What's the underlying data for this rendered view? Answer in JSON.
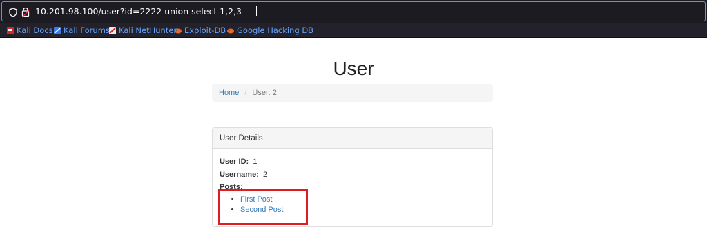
{
  "browser": {
    "url": "10.201.98.100/user?id=2222 union select 1,2,3-- -",
    "bookmarks": [
      {
        "label": "Kali Docs",
        "icon": "kali-docs-icon"
      },
      {
        "label": "Kali Forums",
        "icon": "kali-forums-icon"
      },
      {
        "label": "Kali NetHunter",
        "icon": "kali-nethunter-icon"
      },
      {
        "label": "Exploit-DB",
        "icon": "exploit-db-icon"
      },
      {
        "label": "Google Hacking DB",
        "icon": "google-hacking-db-icon"
      }
    ]
  },
  "page": {
    "title": "User",
    "breadcrumb": {
      "home": "Home",
      "separator": "/",
      "current": "User: 2"
    },
    "panel": {
      "heading": "User Details",
      "user_id_label": "User ID:",
      "user_id_value": "1",
      "username_label": "Username:",
      "username_value": "2",
      "posts_label": "Posts:",
      "posts": [
        "First Post",
        "Second Post"
      ]
    }
  },
  "colors": {
    "chrome_bg": "#1c1b22",
    "bookmark_bar_bg": "#23222b",
    "bookmark_text": "#67a3ff",
    "link": "#337ab7",
    "highlight_box": "#e11b22"
  }
}
